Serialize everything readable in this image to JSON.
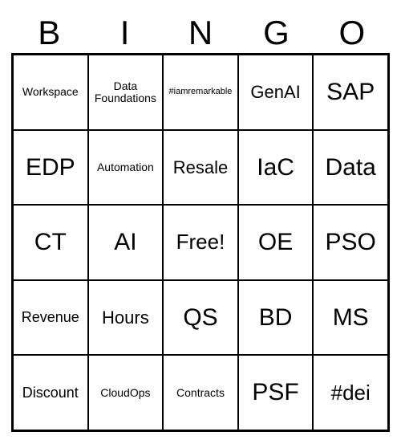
{
  "header": [
    "B",
    "I",
    "N",
    "G",
    "O"
  ],
  "cells": [
    [
      {
        "text": "Workspace",
        "size": "fs-sm"
      },
      {
        "text": "Data Foundations",
        "size": "fs-sm"
      },
      {
        "text": "#iamremarkable",
        "size": "fs-xs"
      },
      {
        "text": "GenAI",
        "size": "fs-lg"
      },
      {
        "text": "SAP",
        "size": "fs-xxl"
      }
    ],
    [
      {
        "text": "EDP",
        "size": "fs-xxl"
      },
      {
        "text": "Automation",
        "size": "fs-sm"
      },
      {
        "text": "Resale",
        "size": "fs-lg"
      },
      {
        "text": "IaC",
        "size": "fs-xxl"
      },
      {
        "text": "Data",
        "size": "fs-xxl"
      }
    ],
    [
      {
        "text": "CT",
        "size": "fs-xxl"
      },
      {
        "text": "AI",
        "size": "fs-xxl"
      },
      {
        "text": "Free!",
        "size": "fs-xl"
      },
      {
        "text": "OE",
        "size": "fs-xxl"
      },
      {
        "text": "PSO",
        "size": "fs-xxl"
      }
    ],
    [
      {
        "text": "Revenue",
        "size": "fs-md"
      },
      {
        "text": "Hours",
        "size": "fs-lg"
      },
      {
        "text": "QS",
        "size": "fs-xxl"
      },
      {
        "text": "BD",
        "size": "fs-xxl"
      },
      {
        "text": "MS",
        "size": "fs-xxl"
      }
    ],
    [
      {
        "text": "Discount",
        "size": "fs-md"
      },
      {
        "text": "CloudOps",
        "size": "fs-sm"
      },
      {
        "text": "Contracts",
        "size": "fs-sm"
      },
      {
        "text": "PSF",
        "size": "fs-xxl"
      },
      {
        "text": "#dei",
        "size": "fs-xl"
      }
    ]
  ],
  "chart_data": {
    "type": "table",
    "title": "BINGO",
    "columns": [
      "B",
      "I",
      "N",
      "G",
      "O"
    ],
    "rows": [
      [
        "Workspace",
        "Data Foundations",
        "#iamremarkable",
        "GenAI",
        "SAP"
      ],
      [
        "EDP",
        "Automation",
        "Resale",
        "IaC",
        "Data"
      ],
      [
        "CT",
        "AI",
        "Free!",
        "OE",
        "PSO"
      ],
      [
        "Revenue",
        "Hours",
        "QS",
        "BD",
        "MS"
      ],
      [
        "Discount",
        "CloudOps",
        "Contracts",
        "PSF",
        "#dei"
      ]
    ]
  }
}
